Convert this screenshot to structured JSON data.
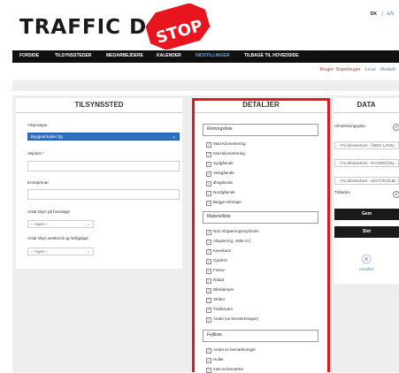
{
  "header": {
    "logo_text": "TRAFFIC DOK",
    "stop_sign_text": "STOP",
    "languages": [
      "DK",
      "EN"
    ],
    "lang_separator": "|"
  },
  "nav": {
    "items": [
      "FORSIDE",
      "TILSYNSSTEDER",
      "MEDARBEJDERE",
      "KALENDER",
      "INDSTILLINGER",
      "TILBAGE TIL HOVEDSIDE"
    ],
    "active_index": 4
  },
  "userbar": {
    "user": "Bruger: Superbruger",
    "lock": "Locel",
    "other": "Medarb"
  },
  "tilsynssted": {
    "title": "TILSYNSSTED",
    "tilsynstype_label": "Tilsynstype",
    "tilsynstype_value": "Byggearbejder (tg",
    "vejnavn_label": "Vejnavn *",
    "entreprenor_label": "Entreprenør",
    "hverdage_label": "Antal tilsyn på hverdage",
    "hverdage_value": "-- Ingen --",
    "weekend_label": "Antal tilsyn weekend og helligdage",
    "weekend_value": "-- Ingen --"
  },
  "detaljer": {
    "title": "DETALJER",
    "groups": [
      {
        "title": "Retningsliste",
        "items": [
          "Med Kilometrering",
          "Mod kilometrering",
          "Sydgående",
          "Vestgående",
          "Østgående",
          "Nordgående",
          "Begge retninger"
        ]
      },
      {
        "title": "Materielliste",
        "items": [
          "N44 Afspærringsmyrbrder",
          "Afspærring, skilte m.f.",
          "Kanekaos",
          "Cykelsti",
          "Fortov",
          "Rabat",
          "Blinklamper",
          "Striber",
          "Trafiksvarn",
          "Andet (se bemærkninger)"
        ]
      },
      {
        "title": "Fejlliste",
        "items": [
          "Andet se bemærkninger",
          "Huller",
          "Intet at bemærke"
        ]
      }
    ]
  },
  "data": {
    "title": "DATA",
    "afmaerk_label": "Afmærkningsplan",
    "vaelg_options": [
      "- Fra bibliotekset - ÅBEN LAND -",
      "- Fra bibliotekset - BYOMRÅDE -",
      "- Fra bibliotekset - MOTORVEJE -"
    ],
    "tilsladen_label": "Tilsladen",
    "gem_label": "Gem",
    "slet_label": "Slet",
    "annuller_label": "Annuller",
    "close_icon": "close-circle-icon"
  },
  "colors": {
    "accent_red": "#e8141e",
    "nav_bg": "#111111",
    "select_blue": "#2f6fbf"
  }
}
